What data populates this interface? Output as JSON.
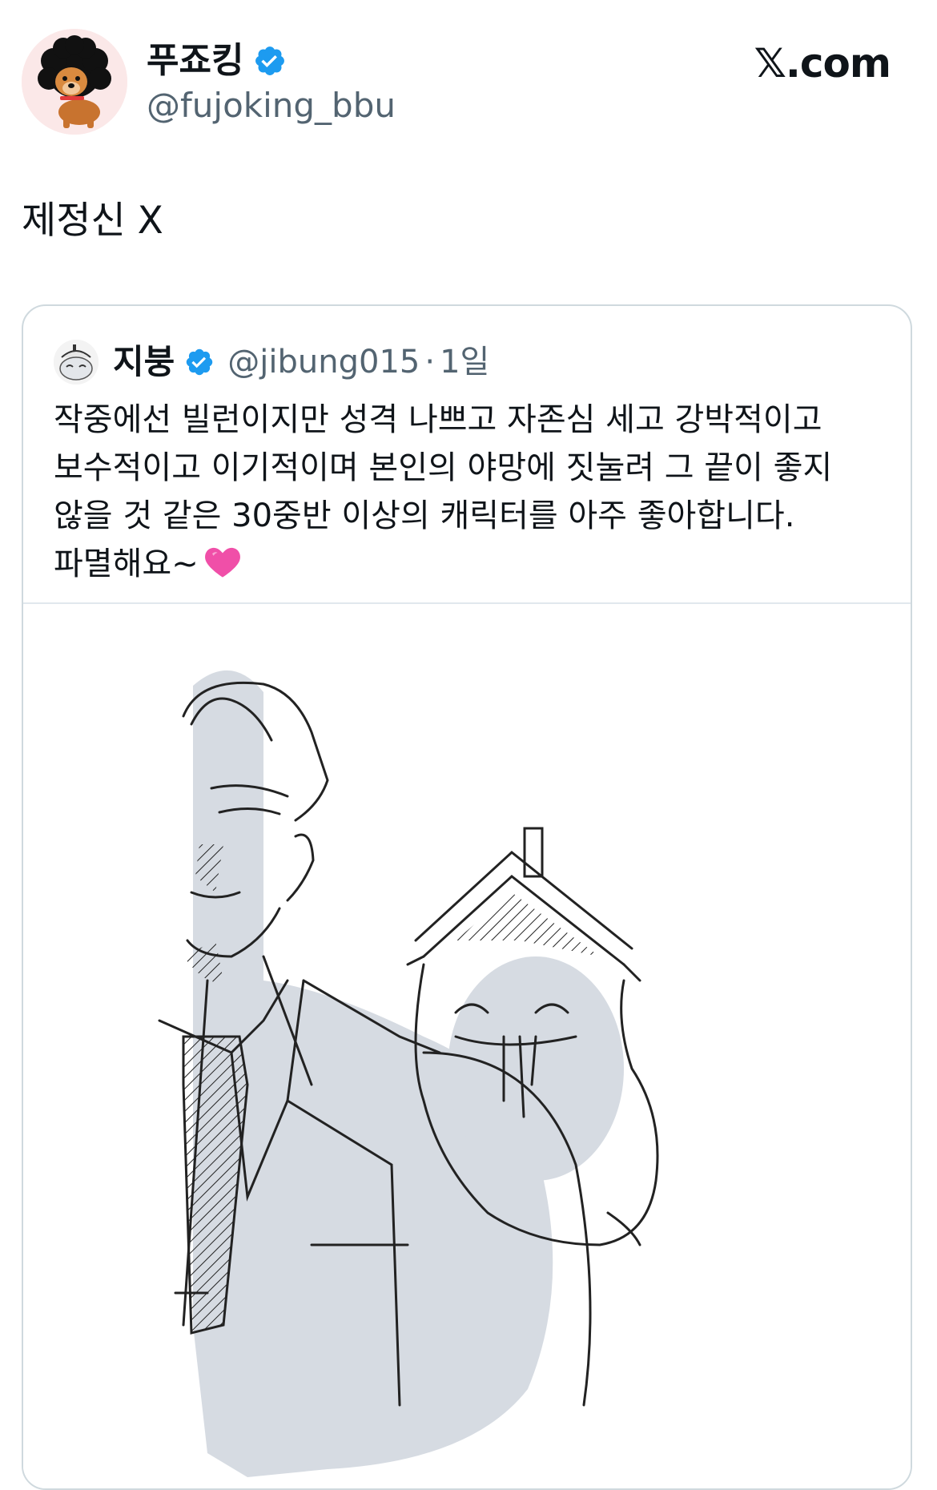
{
  "author": {
    "display_name": "푸죠킹",
    "handle": "@fujoking_bbu",
    "avatar_icon": "dog-avatar-icon",
    "verified_icon": "verified-badge-icon"
  },
  "brand": {
    "label": "𝕏.com"
  },
  "tweet": {
    "text": "제정신 X"
  },
  "quoted_tweet": {
    "display_name": "지붕",
    "handle": "@jibung015",
    "separator": "·",
    "time": "1일",
    "avatar_icon": "smiling-face-avatar-icon",
    "verified_icon": "verified-badge-icon",
    "body_lines": [
      "작중에선 빌런이지만 성격 나쁘고 자존심 세고 강박적이고",
      "보수적이고 이기적이며 본인의 야망에 짓눌려 그 끝이 좋지",
      "않을 것 같은 30중반 이상의 캐릭터를 아주 좋아합니다.",
      "파멸해요~"
    ],
    "emoji": "pink-heart-icon",
    "image_description_icon": "sketch-illustration"
  },
  "colors": {
    "text_primary": "#0f1419",
    "text_secondary": "#536471",
    "verified_blue": "#1d9bf0",
    "card_border": "#cfd9de",
    "heart_pink": "#f04fa8",
    "sketch_shade": "#d6dbe2"
  }
}
